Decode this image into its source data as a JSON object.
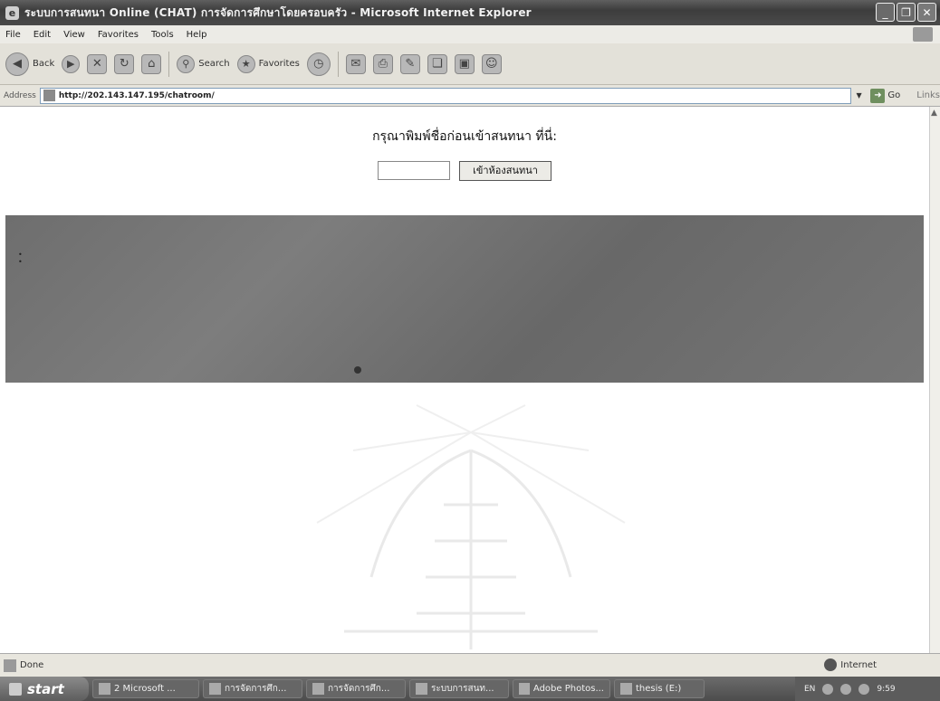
{
  "window": {
    "title": "ระบบการสนทนา Online (CHAT) การจัดการศึกษาโดยครอบครัว - Microsoft Internet Explorer",
    "buttons": [
      "_",
      "❐",
      "✕"
    ]
  },
  "menu": [
    "File",
    "Edit",
    "View",
    "Favorites",
    "Tools",
    "Help"
  ],
  "toolbar": {
    "back_label": "Back",
    "search_label": "Search",
    "favorites_label": "Favorites"
  },
  "address": {
    "label": "Address",
    "url": "http://202.143.147.195/chatroom/",
    "go_label": "Go",
    "links_label": "Links"
  },
  "page": {
    "prompt": "กรุณาพิมพ์ชื่อก่อนเข้าสนทนา ที่นี่:",
    "name_value": "",
    "enter_button": "เข้าห้องสนทนา"
  },
  "status": {
    "text": "Done",
    "zone": "Internet"
  },
  "taskbar": {
    "start": "start",
    "tasks": [
      "2 Microsoft ...",
      "การจัดการศึก...",
      "การจัดการศึก...",
      "ระบบการสนท...",
      "Adobe Photos...",
      "thesis (E:)"
    ],
    "tray_lang": "EN",
    "clock": "9:59"
  }
}
